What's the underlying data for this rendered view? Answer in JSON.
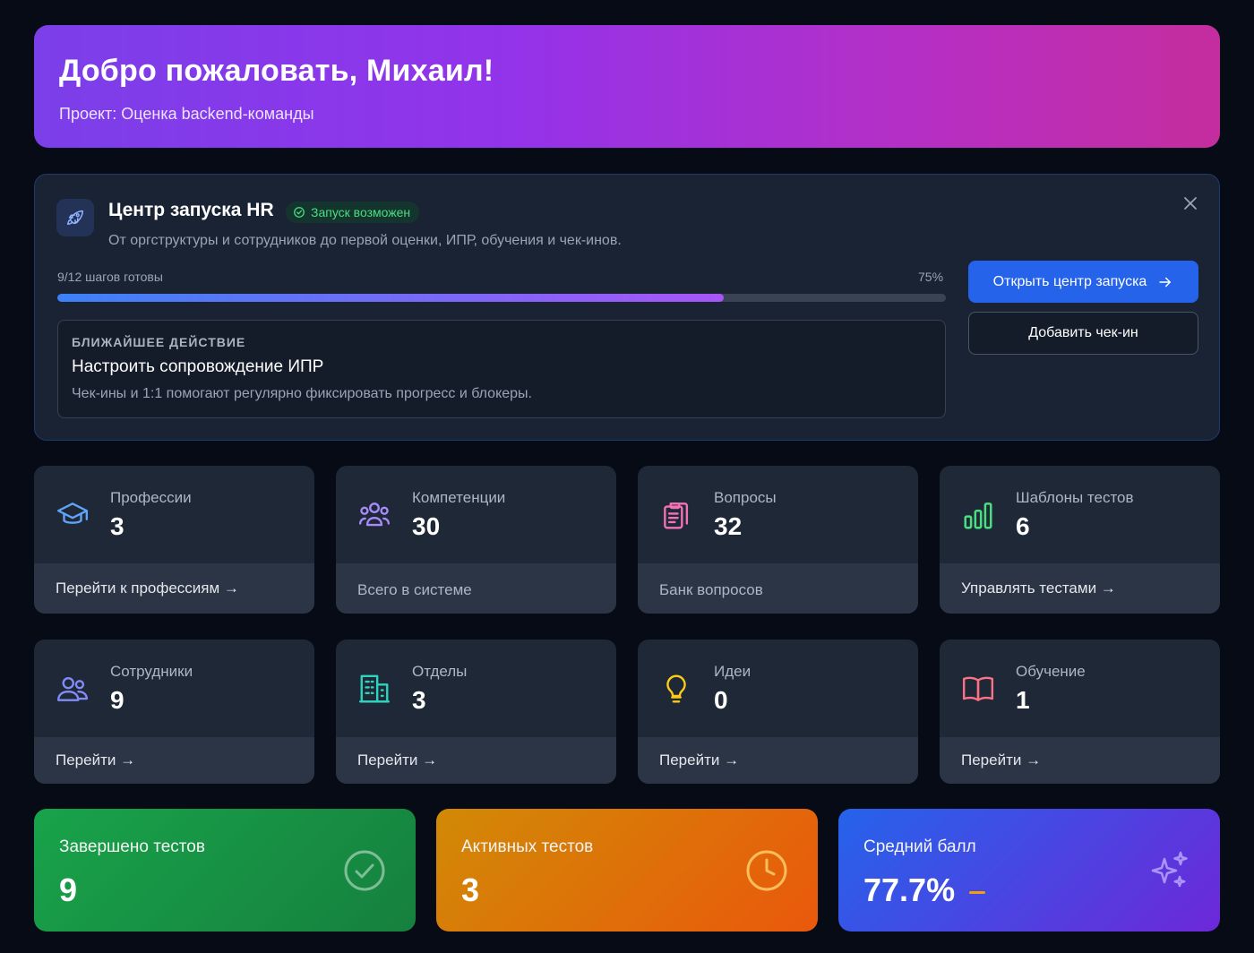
{
  "header": {
    "title": "Добро пожаловать, Михаил!",
    "project": "Проект: Оценка backend-команды"
  },
  "launch_center": {
    "title": "Центр запуска HR",
    "badge": "Запуск возможен",
    "description": "От оргструктуры и сотрудников до первой оценки, ИПР, обучения и чек-инов.",
    "progress_label": "9/12 шагов готовы",
    "progress_percent_label": "75%",
    "progress_fraction": 0.75,
    "next_action": {
      "caption": "БЛИЖАЙШЕЕ ДЕЙСТВИЕ",
      "title": "Настроить сопровождение ИПР",
      "description": "Чек-ины и 1:1 помогают регулярно фиксировать прогресс и блокеры."
    },
    "open_button": "Открыть центр запуска",
    "add_checkin_button": "Добавить чек-ин"
  },
  "cards": [
    {
      "label": "Профессии",
      "value": "3",
      "footer": "Перейти к профессиям →",
      "icon": "graduation-cap-icon",
      "color": "#60a5fa"
    },
    {
      "label": "Компетенции",
      "value": "30",
      "footer": "Всего в системе",
      "icon": "users-group-icon",
      "color": "#a78bfa"
    },
    {
      "label": "Вопросы",
      "value": "32",
      "footer": "Банк вопросов",
      "icon": "clipboard-icon",
      "color": "#f472b6"
    },
    {
      "label": "Шаблоны тестов",
      "value": "6",
      "footer": "Управлять тестами →",
      "icon": "bar-chart-icon",
      "color": "#4ade80"
    },
    {
      "label": "Сотрудники",
      "value": "9",
      "footer": "Перейти →",
      "icon": "users-icon",
      "color": "#818cf8"
    },
    {
      "label": "Отделы",
      "value": "3",
      "footer": "Перейти →",
      "icon": "building-icon",
      "color": "#2dd4bf"
    },
    {
      "label": "Идеи",
      "value": "0",
      "footer": "Перейти →",
      "icon": "lightbulb-icon",
      "color": "#facc15"
    },
    {
      "label": "Обучение",
      "value": "1",
      "footer": "Перейти →",
      "icon": "book-icon",
      "color": "#fb7185"
    }
  ],
  "stats": [
    {
      "label": "Завершено тестов",
      "value": "9",
      "icon": "check-circle-icon"
    },
    {
      "label": "Активных тестов",
      "value": "3",
      "icon": "clock-icon"
    },
    {
      "label": "Средний балл",
      "value": "77.7%",
      "icon": "sparkles-icon",
      "trend": "neutral-dash"
    }
  ]
}
